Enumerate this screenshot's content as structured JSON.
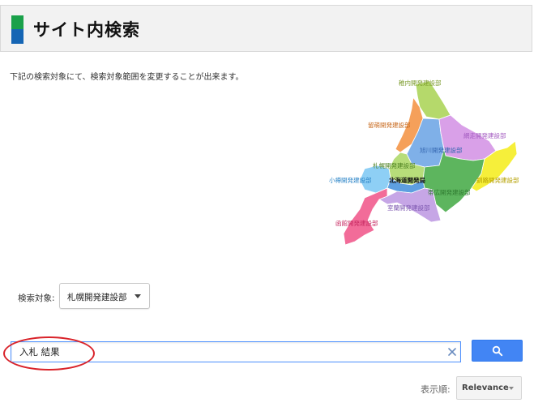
{
  "header": {
    "title": "サイト内検索",
    "logo_colors": [
      "#1aa14a",
      "#1565b4"
    ]
  },
  "intro_text": "下記の検索対象にて、検索対象範囲を変更することが出来ます。",
  "map": {
    "regions": [
      {
        "label": "稚内開発建設部",
        "color": "#b5d96b"
      },
      {
        "label": "留萌開発建設部",
        "color": "#f5a05a"
      },
      {
        "label": "網走開発建設部",
        "color": "#d9a0e8"
      },
      {
        "label": "旭川開発建設部",
        "color": "#7fb0e8"
      },
      {
        "label": "札幌開発建設部",
        "color": "#b7dd7a"
      },
      {
        "label": "小樽開発建設部",
        "color": "#8ecff5"
      },
      {
        "label": "北海道開発局",
        "color": "#5e9fe0"
      },
      {
        "label": "帯広開発建設部",
        "color": "#5db55e"
      },
      {
        "label": "釧路開発建設部",
        "color": "#f6ef3a"
      },
      {
        "label": "室蘭開発建設部",
        "color": "#c6a6e6"
      },
      {
        "label": "函館開発建設部",
        "color": "#f26c99"
      }
    ]
  },
  "search_target": {
    "label": "検索対象:",
    "selected": "札幌開発建設部"
  },
  "search": {
    "value": "入札 結果",
    "accent": "#4285f4",
    "highlight_color": "#d9232a"
  },
  "sort": {
    "label": "表示順:",
    "selected": "Relevance"
  }
}
